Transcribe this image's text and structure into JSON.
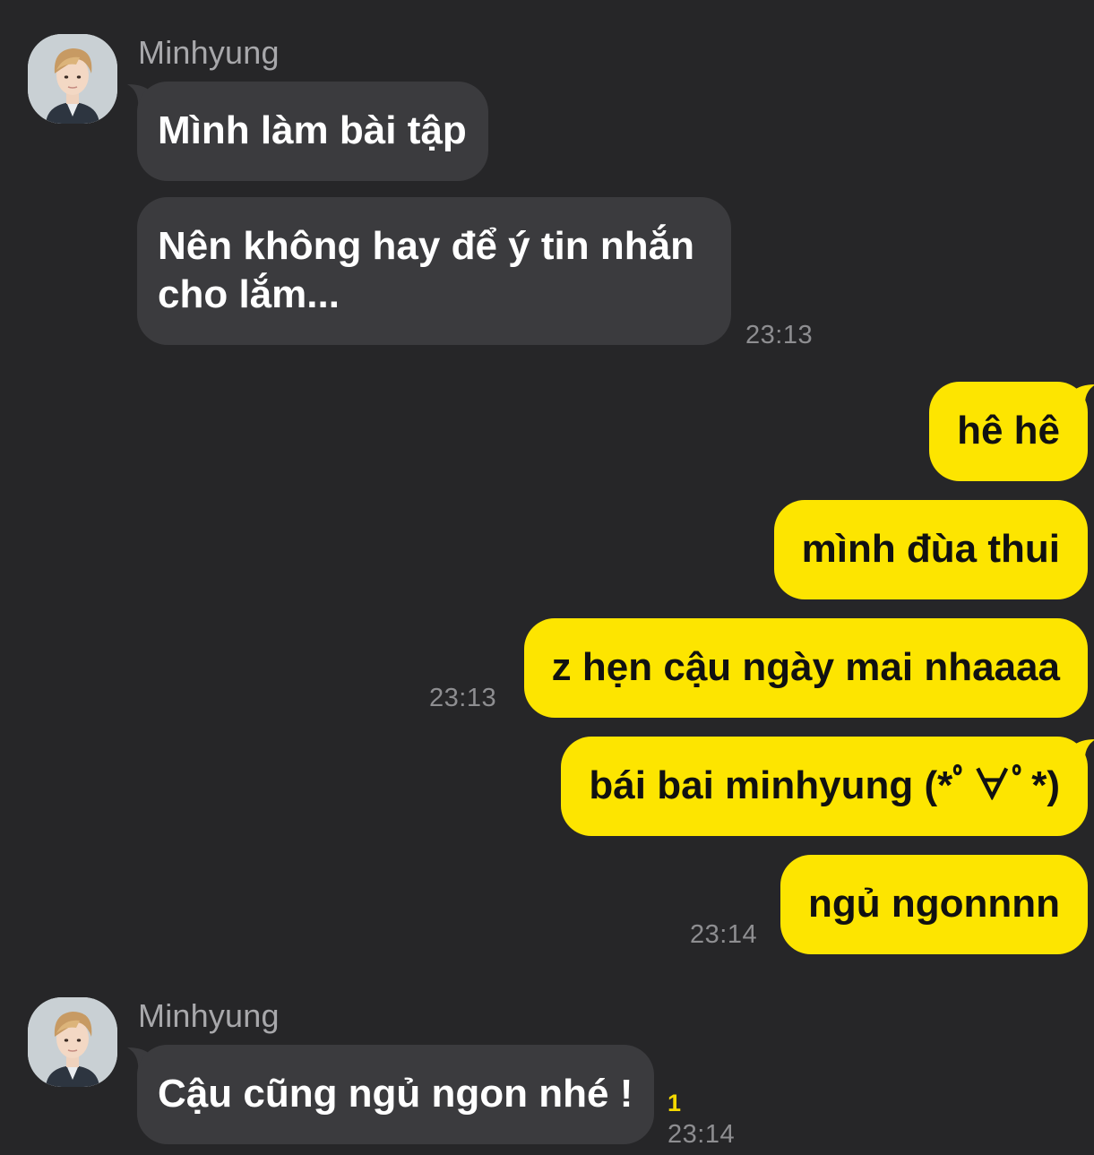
{
  "conversation": {
    "group1": {
      "sender_name": "Minhyung",
      "messages": [
        {
          "text": "Mình làm bài tập"
        },
        {
          "lines": [
            "Nên không hay để ý tin nhắn",
            "cho lắm..."
          ]
        }
      ],
      "time": "23:13"
    },
    "my_group1": {
      "messages": [
        {
          "text": "hê hê"
        },
        {
          "text": "mình đùa thui"
        },
        {
          "text": "z hẹn cậu ngày mai nhaaaa"
        }
      ],
      "time": "23:13"
    },
    "my_group2": {
      "messages": [
        {
          "text": "bái bai minhyung (*ﾟ∀ﾟ*)"
        },
        {
          "text": "ngủ ngonnnn"
        }
      ],
      "time": "23:14"
    },
    "group2": {
      "sender_name": "Minhyung",
      "messages": [
        {
          "text": "Cậu cũng ngủ ngon nhé !"
        }
      ],
      "unread_count": "1",
      "time": "23:14"
    }
  },
  "colors": {
    "background": "#262628",
    "incoming_bubble": "#3b3b3e",
    "outgoing_bubble": "#fde500",
    "timestamp": "#8e8e91",
    "unread_badge": "#f4d800"
  },
  "icons": {
    "avatar": "profile-photo-avatar"
  }
}
